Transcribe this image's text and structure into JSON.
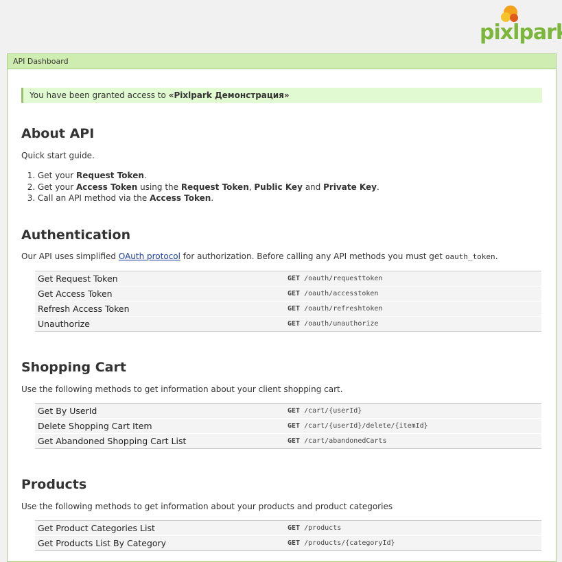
{
  "brand": {
    "logo_text": "pixlpark",
    "logo_icon": "pixlpark-logo-icon"
  },
  "panel": {
    "title": "API Dashboard"
  },
  "notice": {
    "prefix": "You have been granted access to ",
    "account": "«Pixlpark Демонстрация»"
  },
  "about": {
    "heading": "About API",
    "intro": "Quick start guide.",
    "steps": [
      {
        "parts": [
          "Get your ",
          "Request Token",
          "."
        ]
      },
      {
        "parts": [
          "Get your ",
          "Access Token",
          " using the ",
          "Request Token",
          ", ",
          "Public Key",
          " and ",
          "Private Key",
          "."
        ]
      },
      {
        "parts": [
          "Call an API method via the ",
          "Access Token",
          "."
        ]
      }
    ]
  },
  "auth": {
    "heading": "Authentication",
    "desc_before": "Our API uses simplified ",
    "link_text": "OAuth protocol",
    "desc_after": " for authorization. Before calling any API methods you must get ",
    "code": "oauth_token",
    "desc_end": ".",
    "methods": [
      {
        "name": "Get Request Token",
        "verb": "GET",
        "path": "/oauth/requesttoken"
      },
      {
        "name": "Get Access Token",
        "verb": "GET",
        "path": "/oauth/accesstoken"
      },
      {
        "name": "Refresh Access Token",
        "verb": "GET",
        "path": "/oauth/refreshtoken"
      },
      {
        "name": "Unauthorize",
        "verb": "GET",
        "path": "/oauth/unauthorize"
      }
    ]
  },
  "cart": {
    "heading": "Shopping Cart",
    "desc": "Use the following methods to get information about your client shopping cart.",
    "methods": [
      {
        "name": "Get By UserId",
        "verb": "GET",
        "path": "/cart/{userId}"
      },
      {
        "name": "Delete Shopping Cart Item",
        "verb": "GET",
        "path": "/cart/{userId}/delete/{itemId}"
      },
      {
        "name": "Get Abandoned Shopping Cart List",
        "verb": "GET",
        "path": "/cart/abandonedCarts"
      }
    ]
  },
  "products": {
    "heading": "Products",
    "desc": "Use the following methods to get information about your products and product categories",
    "methods": [
      {
        "name": "Get Product Categories List",
        "verb": "GET",
        "path": "/products"
      },
      {
        "name": "Get Products List By Category",
        "verb": "GET",
        "path": "/products/{categoryId}"
      }
    ]
  }
}
